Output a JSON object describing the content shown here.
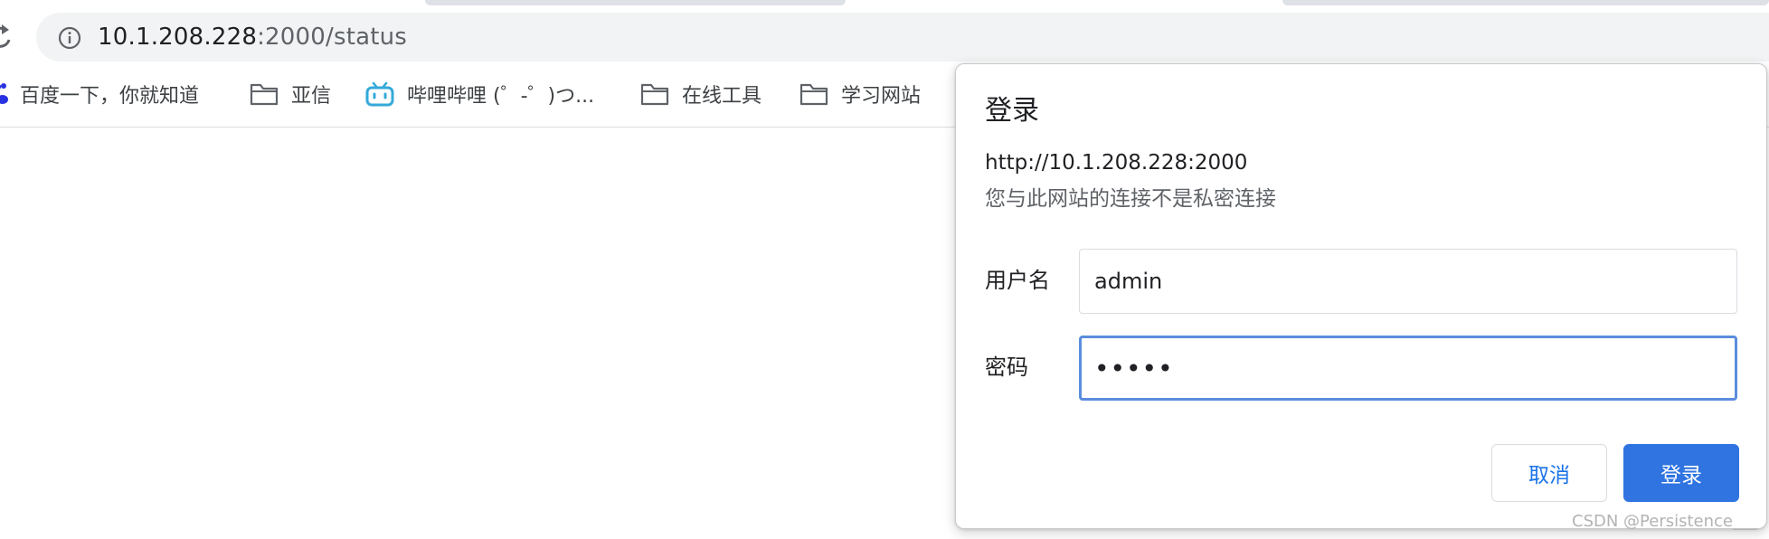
{
  "address_bar": {
    "url_host": "10.1.208.228",
    "url_path": ":2000/status"
  },
  "bookmarks": [
    {
      "label": "百度一下，你就知道",
      "icon": "baidu-paw-icon"
    },
    {
      "label": "亚信",
      "icon": "folder-icon"
    },
    {
      "label": "哔哩哔哩 (゜-゜)つ...",
      "icon": "bilibili-tv-icon"
    },
    {
      "label": "在线工具",
      "icon": "folder-icon"
    },
    {
      "label": "学习网站",
      "icon": "folder-icon"
    }
  ],
  "login_dialog": {
    "title": "登录",
    "origin": "http://10.1.208.228:2000",
    "warning": "您与此网站的连接不是私密连接",
    "username_label": "用户名",
    "username_value": "admin",
    "password_label": "密码",
    "password_value": "•••••",
    "cancel_label": "取消",
    "submit_label": "登录"
  },
  "watermark": "CSDN @Persistence___",
  "colors": {
    "accent": "#2f74e0",
    "focus_ring": "#5b8dde",
    "link_blue": "#1a73e8",
    "omnibox_bg": "#f1f3f4",
    "bilibili": "#35a9d9",
    "baidu": "#2932e1"
  }
}
